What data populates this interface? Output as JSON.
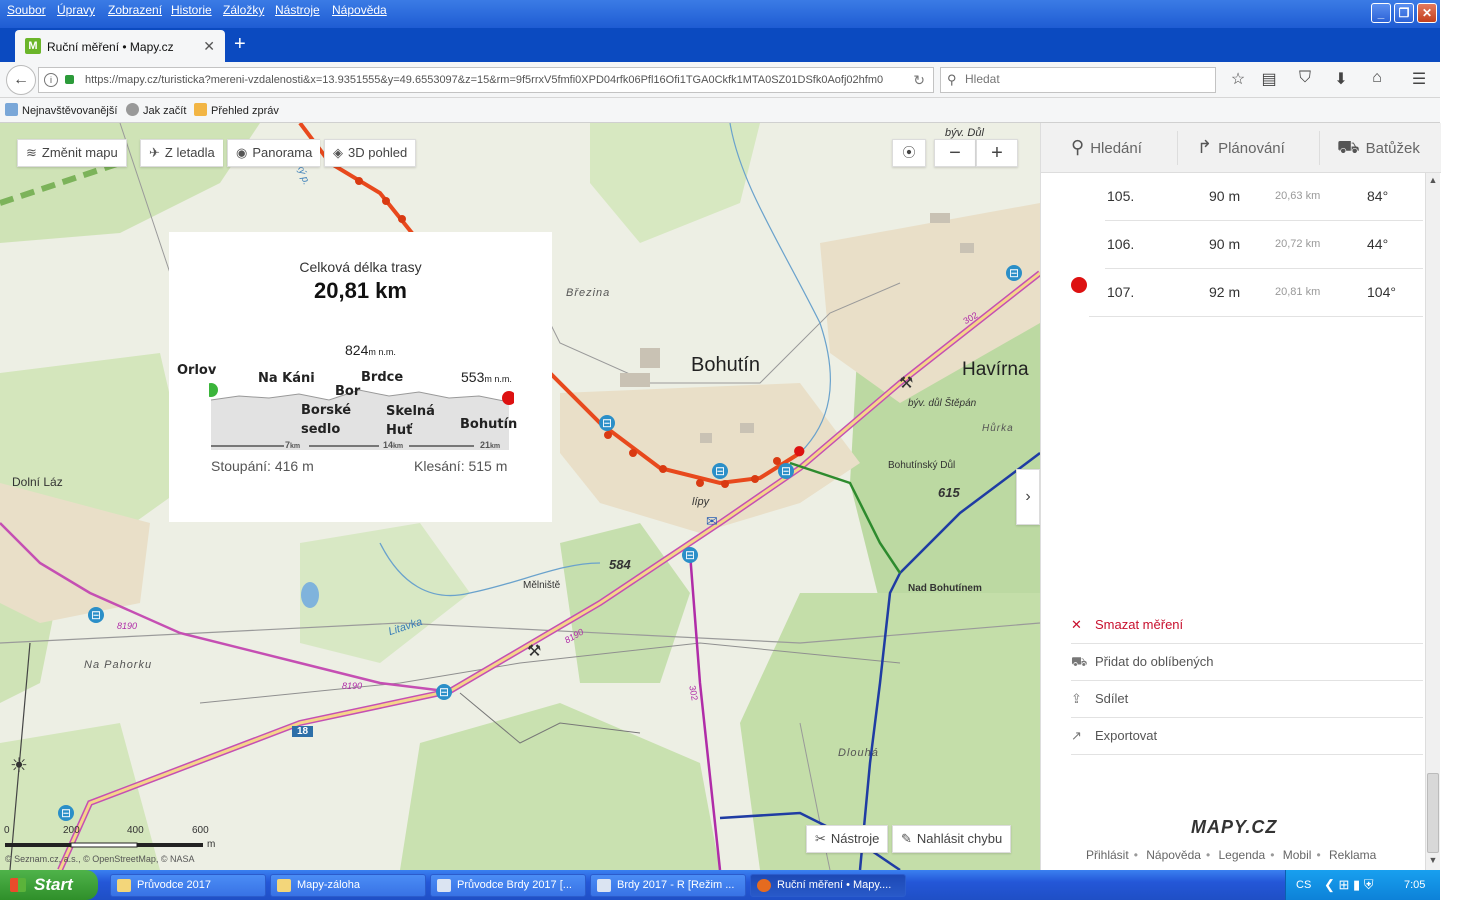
{
  "menubar": {
    "items": [
      "Soubor",
      "Úpravy",
      "Zobrazení",
      "Historie",
      "Záložky",
      "Nástroje",
      "Nápověda"
    ]
  },
  "tab": {
    "title": "Ruční měření • Mapy.cz",
    "favicon": "M"
  },
  "navbar": {
    "url": "https://mapy.cz/turisticka?mereni-vzdalenosti&x=13.9351555&y=49.6553097&z=15&rm=9f5rrxV5fmfi0XPD04rfk06Pfl16Ofi1TGA0Ckfk1MTA0SZ01DSfk0Aofj02hfm0",
    "search_placeholder": "Hledat"
  },
  "bookmarks": [
    "Nejnavštěvovanější",
    "Jak začít",
    "Přehled zpráv"
  ],
  "map": {
    "buttons": {
      "change_map": "Změnit mapu",
      "from_plane": "Z letadla",
      "panorama": "Panorama",
      "3d": "3D pohled"
    },
    "labels": {
      "bohutin": "Bohutín",
      "havirna": "Havírna",
      "dolni_laz": "Dolní Láz",
      "brezina": "Březina",
      "na_pahorku": "Na Pahorku",
      "melniste": "Mělniště",
      "litavka": "Litavka",
      "lipy": "lípy",
      "byv_dul_stepan": "býv. důl Štěpán",
      "hurka": "Hůrka",
      "bohutinsky_dul": "Bohutínský Důl",
      "nad_bohutinem": "Nad Bohutínem",
      "elev_615": "615",
      "elev_584": "584",
      "dlouha": "Dlouhá",
      "byv_dul": "býv. Důl",
      "road_8190a": "8190",
      "road_8190b": "8190",
      "road_8190c": "8190",
      "road_302a": "302",
      "road_302b": "302",
      "road_18": "18",
      "stream": "ský p."
    },
    "scale": [
      "0",
      "200",
      "400",
      "600",
      "m"
    ],
    "copyright": "© Seznam.cz, a.s., © OpenStreetMap, © NASA",
    "tools": "Nástroje",
    "report": "Nahlásit chybu"
  },
  "profile": {
    "title": "Celková délka trasy",
    "length": "20,81 km",
    "max_elevation": "824",
    "end_elevation": "553",
    "unit": "m n.m.",
    "places": [
      "Orlov",
      "Na Káni",
      "Bor",
      "Brdce",
      "Borské sedlo",
      "Skelná Huť",
      "Bohutín"
    ],
    "km_marks": [
      "7",
      "14",
      "21"
    ],
    "km_unit": "km",
    "climb": "Stoupání: 416 m",
    "descent": "Klesání: 515 m"
  },
  "panel": {
    "tabs": [
      "Hledání",
      "Plánování",
      "Batůžek"
    ],
    "rows": [
      {
        "n": "105.",
        "dist": "90 m",
        "total": "20,63 km",
        "angle": "84°"
      },
      {
        "n": "106.",
        "dist": "90 m",
        "total": "20,72 km",
        "angle": "44°"
      },
      {
        "n": "107.",
        "dist": "92 m",
        "total": "20,81 km",
        "angle": "104°"
      }
    ],
    "actions": {
      "delete": "Smazat měření",
      "favorite": "Přidat do oblíbených",
      "share": "Sdílet",
      "export": "Exportovat"
    },
    "logo": "MAPY.CZ",
    "footer": [
      "Přihlásit",
      "Nápověda",
      "Legenda",
      "Mobil",
      "Reklama"
    ]
  },
  "taskbar": {
    "start": "Start",
    "tasks": [
      "Průvodce 2017",
      "Mapy-záloha",
      "Průvodce Brdy 2017 [...",
      "Brdy 2017 - R [Režim ...",
      "Ruční měření • Mapy...."
    ],
    "lang": "CS",
    "time": "7:05"
  },
  "colors": {
    "route": "#e8491d",
    "accent_red": "#c8102e",
    "forest": "#c9e0b0",
    "road_purple": "#b02ca8",
    "road_orange": "#f5b46a"
  }
}
